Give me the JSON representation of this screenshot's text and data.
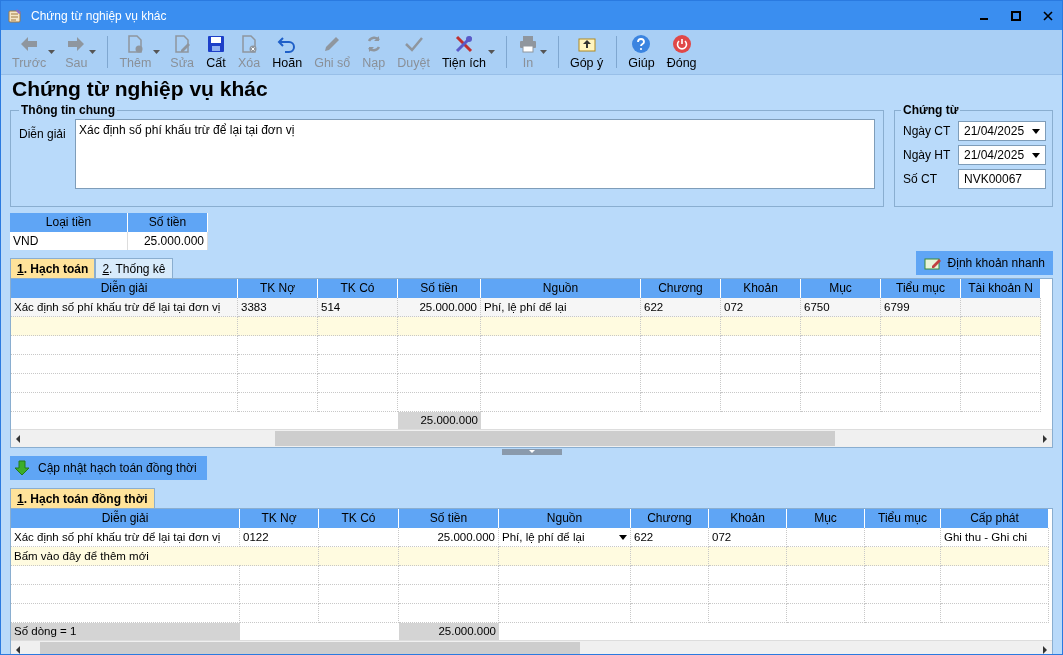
{
  "window": {
    "title": "Chứng từ nghiệp vụ khác"
  },
  "toolbar": [
    {
      "label": "Trước",
      "enabled": false,
      "dropdown": true
    },
    {
      "label": "Sau",
      "enabled": false,
      "dropdown": true
    },
    {
      "label": "Thêm",
      "enabled": false,
      "dropdown": true
    },
    {
      "label": "Sửa",
      "enabled": false,
      "dropdown": false
    },
    {
      "label": "Cất",
      "enabled": true,
      "dropdown": false
    },
    {
      "label": "Xóa",
      "enabled": false,
      "dropdown": false
    },
    {
      "label": "Hoãn",
      "enabled": true,
      "dropdown": false
    },
    {
      "label": "Ghi sổ",
      "enabled": false,
      "dropdown": false
    },
    {
      "label": "Nạp",
      "enabled": false,
      "dropdown": false
    },
    {
      "label": "Duyệt",
      "enabled": false,
      "dropdown": false
    },
    {
      "label": "Tiện ích",
      "enabled": true,
      "dropdown": true
    },
    {
      "label": "In",
      "enabled": false,
      "dropdown": true
    },
    {
      "label": "Góp ý",
      "enabled": true,
      "dropdown": false
    },
    {
      "label": "Giúp",
      "enabled": true,
      "dropdown": false
    },
    {
      "label": "Đóng",
      "enabled": true,
      "dropdown": false
    }
  ],
  "heading": "Chứng từ nghiệp vụ khác",
  "general": {
    "legend": "Thông tin chung",
    "label": "Diễn giải",
    "value": "Xác định số phí khấu trừ để lại tại đơn vị"
  },
  "voucher": {
    "legend": "Chứng từ",
    "fields": [
      {
        "label": "Ngày CT",
        "value": "21/04/2025",
        "kind": "date"
      },
      {
        "label": "Ngày HT",
        "value": "21/04/2025",
        "kind": "date"
      },
      {
        "label": "Số CT",
        "value": "NVK00067",
        "kind": "text"
      }
    ]
  },
  "currency": {
    "columns": [
      "Loại tiền",
      "Số tiền"
    ],
    "rows": [
      [
        "VND",
        "25.000.000"
      ]
    ]
  },
  "tabs": [
    {
      "label": "1. Hạch toán",
      "selected": true
    },
    {
      "label": "2. Thống kê",
      "selected": false
    }
  ],
  "quick_button": "Định khoản nhanh",
  "grid1": {
    "columns": [
      "Diễn giải",
      "TK Nợ",
      "TK Có",
      "Số tiền",
      "Nguồn",
      "Chương",
      "Khoản",
      "Mục",
      "Tiểu mục",
      "Tài khoản N"
    ],
    "rows": [
      {
        "kind": "data",
        "cells": [
          "Xác định số phí khấu trừ để lại tại đơn vị",
          "3383",
          "514",
          "25.000.000",
          "Phí, lệ phí để lại",
          "622",
          "072",
          "6750",
          "6799",
          null
        ]
      },
      {
        "kind": "new"
      }
    ],
    "footer": {
      "amount": "25.000.000"
    }
  },
  "update_button": "Cập nhật hạch toán đồng thời",
  "tabs2": [
    {
      "label": "1. Hạch toán đồng thời",
      "selected": true
    }
  ],
  "grid2": {
    "columns": [
      "Diễn giải",
      "TK Nợ",
      "TK Có",
      "Số tiền",
      "Nguồn",
      "Chương",
      "Khoản",
      "Mục",
      "Tiểu mục",
      "Cấp phát"
    ],
    "rows": [
      {
        "kind": "data",
        "active": true,
        "cells": [
          "Xác định số phí khấu trừ để lại tại đơn vị",
          "0122",
          null,
          "25.000.000",
          "Phí, lệ phí để lại",
          "622",
          "072",
          null,
          null,
          "Ghi thu - Ghi chi"
        ]
      },
      {
        "kind": "new",
        "active": false,
        "text": "Bấm vào đây để thêm mới"
      }
    ],
    "footer": {
      "count": "Số dòng = 1",
      "amount": "25.000.000"
    }
  }
}
